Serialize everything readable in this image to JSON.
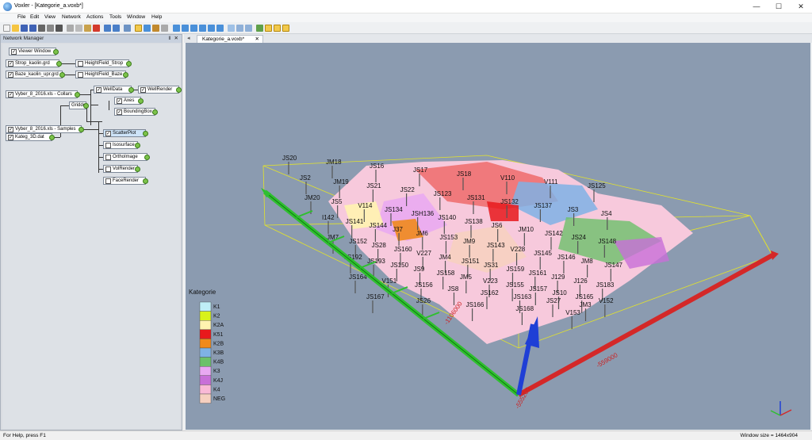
{
  "window": {
    "title": "Voxler - [Kategorie_a.voxb*]",
    "minimize": "—",
    "maximize": "☐",
    "close": "✕"
  },
  "menu": [
    "File",
    "Edit",
    "View",
    "Network",
    "Actions",
    "Tools",
    "Window",
    "Help"
  ],
  "network_manager": {
    "title": "Network Manager",
    "pin": "‖",
    "close": "✕",
    "nodes": {
      "viewer": "Viewer Window",
      "strop_grd": "Strop_kaolin.grd",
      "baze_grd": "Baze_kaolin_upr.grd",
      "hf_strop": "HeightField_Strop",
      "hf_baze": "HeightField_Baze",
      "collars": "Vyber_8_2016.xls - Collars",
      "samples": "Vyber_8_2016.xls - Samples",
      "gridder": "Gridder",
      "welldata": "WellData",
      "wellrender": "WellRender",
      "axes": "Axes",
      "bbox": "BoundingBox",
      "scatter": "ScatterPlot",
      "isosurface": "Isosurface",
      "orthoimage": "OrthoImage",
      "volrender": "VolRender",
      "facerender": "FaceRender",
      "kateg": "Kateg_3D.dat"
    }
  },
  "document_tab": {
    "label": "Kategorie_a.voxb*",
    "close": "✕"
  },
  "legend": {
    "title": "Kategorie",
    "items": [
      {
        "label": "K1",
        "color": "#bfeef7"
      },
      {
        "label": "K2",
        "color": "#d8f21a"
      },
      {
        "label": "K2A",
        "color": "#fff3b0"
      },
      {
        "label": "K51",
        "color": "#e8191c"
      },
      {
        "label": "K2B",
        "color": "#f08a1c"
      },
      {
        "label": "K3B",
        "color": "#7fb2e5"
      },
      {
        "label": "K4B",
        "color": "#6cc16a"
      },
      {
        "label": "K3",
        "color": "#e9a8f2"
      },
      {
        "label": "K4J",
        "color": "#c86fd8"
      },
      {
        "label": "K4",
        "color": "#f9b9d6"
      },
      {
        "label": "NEG",
        "color": "#f6d0c0"
      }
    ]
  },
  "axis": {
    "y_value": "-1106000",
    "x_value": "-559000",
    "origin_value": "-555200"
  },
  "wells": [
    "JS20",
    "JM18",
    "JS16",
    "JS17",
    "JS18",
    "V110",
    "V111",
    "JS125",
    "JS2",
    "JM19",
    "JS21",
    "JS22",
    "JS123",
    "JS131",
    "JS132",
    "JS137",
    "JS3",
    "JS4",
    "JM20",
    "JS5",
    "V114",
    "JS134",
    "JSH136",
    "JS140",
    "JS138",
    "JS6",
    "JM10",
    "JS142",
    "JS24",
    "JS148",
    "I142",
    "JS141",
    "JS144",
    "J37",
    "JM6",
    "JS153",
    "JM9",
    "JS143",
    "V228",
    "JS145",
    "JS146",
    "JM8",
    "JS147",
    "JM7",
    "JS152",
    "JS28",
    "JS160",
    "V227",
    "JM4",
    "JS151",
    "JS31",
    "JS159",
    "JS161",
    "J129",
    "J126",
    "JS183",
    "JS192",
    "JS193",
    "JS150",
    "JS9",
    "JS158",
    "JM5",
    "V223",
    "JS155",
    "JS157",
    "JS10",
    "JS165",
    "V152",
    "JS164",
    "V151",
    "JS156",
    "JS8",
    "JS162",
    "JS163",
    "JS27",
    "JM3",
    "JS167",
    "JS26",
    "JS166",
    "JS168",
    "V153"
  ],
  "status": {
    "help": "For Help, press F1",
    "window_size": "Window size = 1464x904"
  }
}
